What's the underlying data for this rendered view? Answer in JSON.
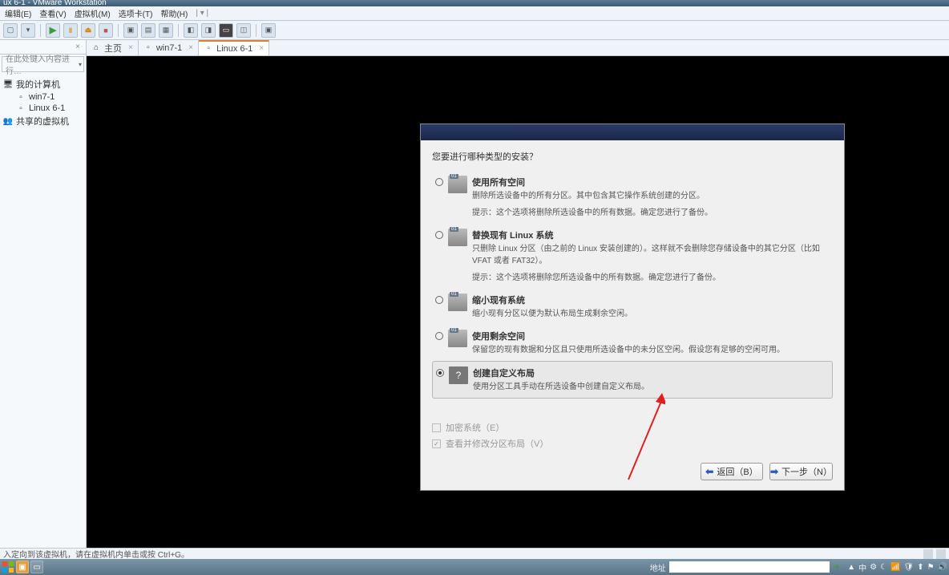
{
  "window": {
    "title": "ux 6-1 - VMware Workstation"
  },
  "menu": {
    "file": "编辑(E)",
    "view": "查看(V)",
    "vm": "虚拟机(M)",
    "tabs": "选项卡(T)",
    "help": "帮助(H)"
  },
  "sidebar": {
    "search_placeholder": "在此处键入内容进行…",
    "root": "我的计算机",
    "items": [
      "win7-1",
      "Linux 6-1"
    ],
    "shared": "共享的虚拟机"
  },
  "tabs": {
    "home": "主页",
    "t1": "win7-1",
    "t2": "Linux 6-1"
  },
  "installer": {
    "prompt": "您要进行哪种类型的安装？",
    "options": [
      {
        "title": "使用所有空间",
        "desc": "删除所选设备中的所有分区。其中包含其它操作系统创建的分区。",
        "hint": "提示：这个选项将删除所选设备中的所有数据。确定您进行了备份。"
      },
      {
        "title": "替换现有 Linux 系统",
        "desc": "只删除 Linux 分区（由之前的 Linux 安装创建的）。这样就不会删除您存储设备中的其它分区（比如 VFAT 或者 FAT32）。",
        "hint": "提示：这个选项将删除您所选设备中的所有数据。确定您进行了备份。"
      },
      {
        "title": "缩小现有系统",
        "desc": "缩小现有分区以便为默认布局生成剩余空闲。",
        "hint": ""
      },
      {
        "title": "使用剩余空间",
        "desc": "保留您的现有数据和分区且只使用所选设备中的未分区空闲。假设您有足够的空闲可用。",
        "hint": ""
      },
      {
        "title": "创建自定义布局",
        "desc": "使用分区工具手动在所选设备中创建自定义布局。",
        "hint": ""
      }
    ],
    "check_encrypt": "加密系统（E）",
    "check_review": "查看并修改分区布局（V）",
    "back": "返回（B）",
    "next": "下一步（N）"
  },
  "statusbar": {
    "hint": "入定向到该虚拟机，请在虚拟机内单击或按 Ctrl+G。"
  },
  "taskbar": {
    "addr_label": "地址"
  }
}
